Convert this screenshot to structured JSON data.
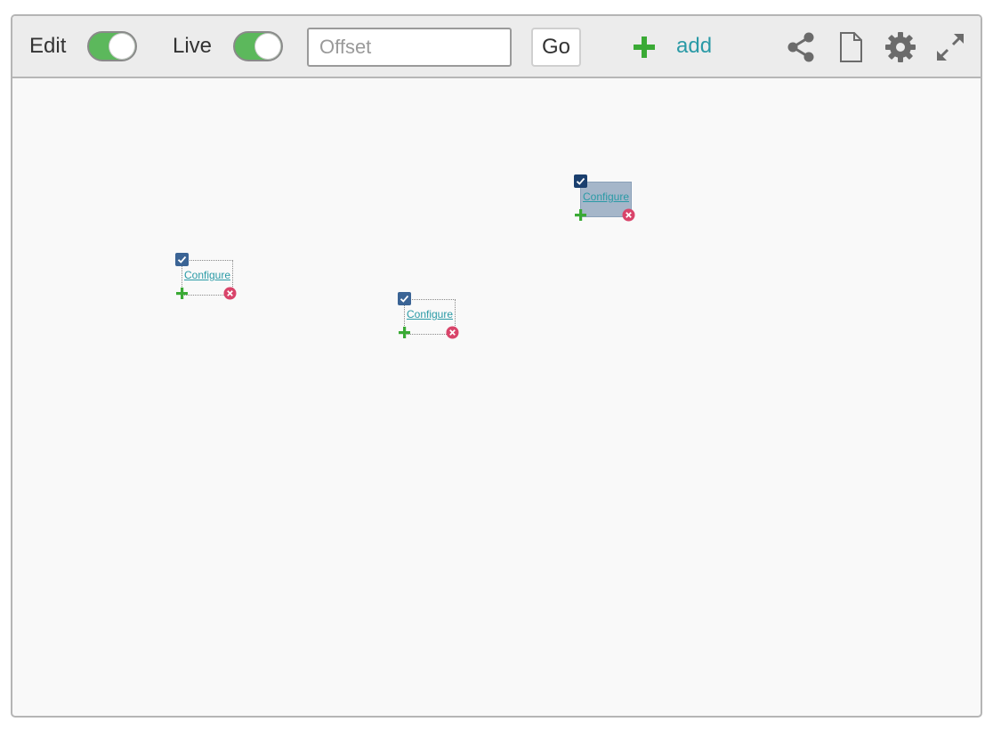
{
  "toolbar": {
    "edit_label": "Edit",
    "edit_on": true,
    "live_label": "Live",
    "live_on": true,
    "offset_placeholder": "Offset",
    "offset_value": "",
    "go_label": "Go",
    "add_label": "add",
    "icons": [
      "share-icon",
      "document-icon",
      "gear-icon",
      "fullscreen-icon"
    ]
  },
  "widgets": [
    {
      "configure_label": "Configure",
      "selected": false
    },
    {
      "configure_label": "Configure",
      "selected": false
    },
    {
      "configure_label": "Configure",
      "selected": true
    }
  ],
  "colors": {
    "toggle_on": "#5cb85c",
    "link": "#2a9aa6",
    "add_icon": "#3aaa35",
    "remove_icon": "#d9446a",
    "check": "#3b6495",
    "icon_gray": "#6b6b6b"
  }
}
